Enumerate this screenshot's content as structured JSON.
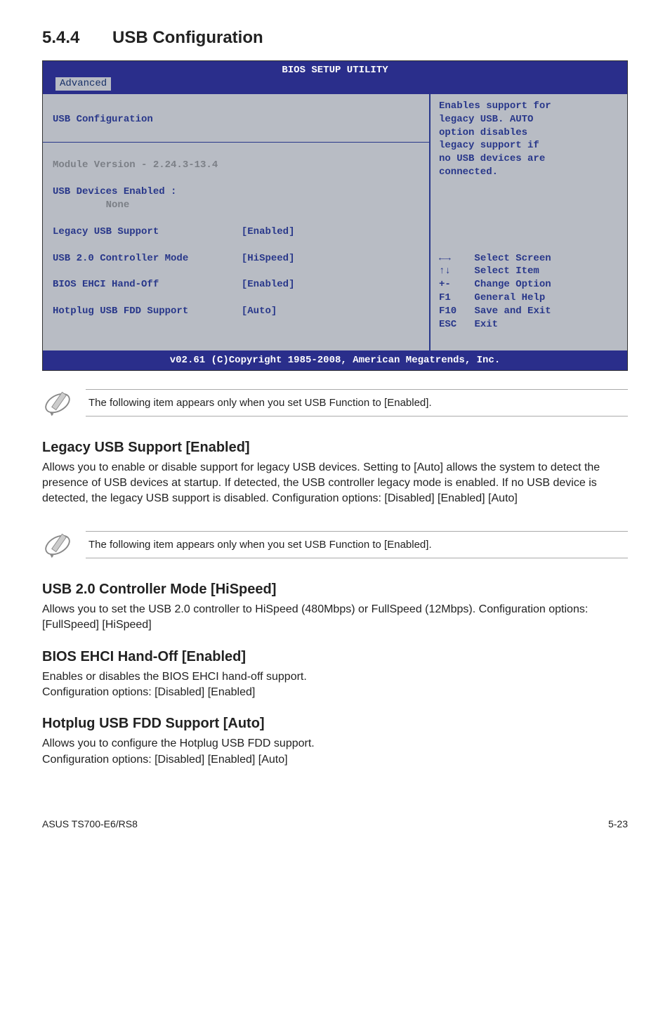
{
  "heading": {
    "number": "5.4.4",
    "title": "USB Configuration"
  },
  "bios": {
    "title": "BIOS SETUP UTILITY",
    "tab": "Advanced",
    "left": {
      "section_title": "USB Configuration",
      "module_version_label": "Module Version - 2.24.3-13.4",
      "devices_enabled_label": "USB Devices Enabled :",
      "devices_enabled_value": "None",
      "rows": [
        {
          "label": "Legacy USB Support",
          "value": "[Enabled]"
        },
        {
          "label": "USB 2.0 Controller Mode",
          "value": "[HiSpeed]"
        },
        {
          "label": "BIOS EHCI Hand-Off",
          "value": "[Enabled]"
        },
        {
          "label": "Hotplug USB FDD Support",
          "value": "[Auto]"
        }
      ]
    },
    "right_help": "Enables support for\nlegacy USB. AUTO\noption disables\nlegacy support if\nno USB devices are\nconnected.",
    "nav": [
      {
        "key": "←→",
        "label": "Select Screen"
      },
      {
        "key": "↑↓",
        "label": "Select Item"
      },
      {
        "key": "+-",
        "label": "Change Option"
      },
      {
        "key": "F1",
        "label": "General Help"
      },
      {
        "key": "F10",
        "label": "Save and Exit"
      },
      {
        "key": "ESC",
        "label": "Exit"
      }
    ],
    "footer": "v02.61 (C)Copyright 1985-2008, American Megatrends, Inc."
  },
  "note1": "The following item appears only when you set USB Function to [Enabled].",
  "h3_1": "Legacy USB Support [Enabled]",
  "p1": "Allows you to enable or disable support for legacy USB devices. Setting to [Auto] allows the system to detect the presence of USB devices at startup. If detected, the USB controller legacy mode is enabled. If no USB device is detected, the legacy USB support is disabled. Configuration options: [Disabled] [Enabled] [Auto]",
  "note2": "The following item appears only when you set USB Function to [Enabled].",
  "h3_2": "USB 2.0 Controller Mode [HiSpeed]",
  "p2": "Allows you to set the USB 2.0 controller to HiSpeed (480Mbps) or FullSpeed (12Mbps). Configuration options: [FullSpeed] [HiSpeed]",
  "h3_3": "BIOS EHCI Hand-Off [Enabled]",
  "p3": "Enables or disables the BIOS EHCI hand-off support.\nConfiguration options: [Disabled] [Enabled]",
  "h3_4": "Hotplug USB FDD Support [Auto]",
  "p4": "Allows you to configure the Hotplug USB FDD support.\nConfiguration options: [Disabled] [Enabled] [Auto]",
  "footer_left": "ASUS TS700-E6/RS8",
  "footer_right": "5-23"
}
